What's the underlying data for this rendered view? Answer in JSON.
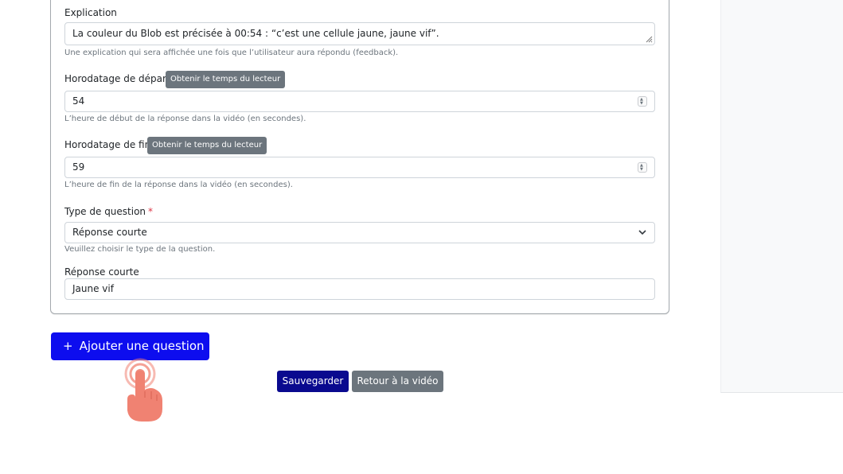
{
  "explication": {
    "label": "Explication",
    "value": "La couleur du Blob est précisée à 00:54 : “c’est une cellule jaune, jaune vif”.",
    "help": "Une explication qui sera affichée une fois que l’utilisateur aura répondu (feedback)."
  },
  "start_time": {
    "label": "Horodatage de départ",
    "button": "Obtenir le temps du lecteur",
    "value": "54",
    "help": "L’heure de début de la réponse dans la vidéo (en secondes)."
  },
  "end_time": {
    "label": "Horodatage de fin",
    "button": "Obtenir le temps du lecteur",
    "value": "59",
    "help": "L’heure de fin de la réponse dans la vidéo (en secondes)."
  },
  "question_type": {
    "label": "Type de question",
    "required_mark": "*",
    "value": "Réponse courte",
    "help": "Veuillez choisir le type de la question."
  },
  "short_answer": {
    "label": "Réponse courte",
    "value": "Jaune vif"
  },
  "actions": {
    "add_plus": "+",
    "add_question": "Ajouter une question",
    "save": "Sauvegarder",
    "back": "Retour à la vidéo"
  },
  "colors": {
    "primary": "#0d0def",
    "save": "#0a0a8f",
    "secondary": "#6c757d",
    "required": "#dc3545",
    "pointer": "#f08272"
  },
  "icons": [
    "resize-handle-icon",
    "spinner-icon",
    "chevron-down-icon",
    "hand-pointer-icon"
  ]
}
